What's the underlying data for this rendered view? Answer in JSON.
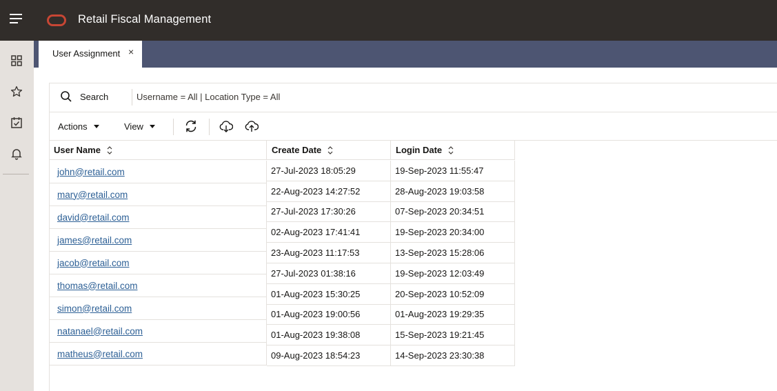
{
  "app": {
    "title": "Retail Fiscal Management"
  },
  "tab": {
    "label": "User Assignment",
    "close": "×"
  },
  "search": {
    "label": "Search",
    "filter": "Username = All | Location Type = All"
  },
  "toolbar": {
    "actions": "Actions",
    "view": "View"
  },
  "table": {
    "columns": [
      "User Name",
      "Create Date",
      "Login Date"
    ],
    "rows": [
      {
        "user": "john@retail.com",
        "create": "27-Jul-2023 18:05:29",
        "login": "19-Sep-2023 11:55:47"
      },
      {
        "user": "mary@retail.com",
        "create": "22-Aug-2023 14:27:52",
        "login": "28-Aug-2023 19:03:58"
      },
      {
        "user": "david@retail.com",
        "create": "27-Jul-2023 17:30:26",
        "login": "07-Sep-2023 20:34:51"
      },
      {
        "user": "james@retail.com",
        "create": "02-Aug-2023 17:41:41",
        "login": "19-Sep-2023 20:34:00"
      },
      {
        "user": "jacob@retail.com",
        "create": "23-Aug-2023 11:17:53",
        "login": "13-Sep-2023 15:28:06"
      },
      {
        "user": "thomas@retail.com",
        "create": "27-Jul-2023 01:38:16",
        "login": "19-Sep-2023 12:03:49"
      },
      {
        "user": "simon@retail.com",
        "create": "01-Aug-2023 15:30:25",
        "login": "20-Sep-2023 10:52:09"
      },
      {
        "user": "natanael@retail.com",
        "create": "01-Aug-2023 19:00:56",
        "login": "01-Aug-2023 19:29:35"
      },
      {
        "user": "matheus@retail.com",
        "create": "01-Aug-2023 19:38:08",
        "login": "15-Sep-2023 19:21:45"
      },
      {
        "user": "",
        "create": "09-Aug-2023 18:54:23",
        "login": "14-Sep-2023 23:30:38"
      }
    ]
  },
  "icons": {
    "menu": "hamburger-menu-icon",
    "brand": "oracle-logo-icon",
    "rail": [
      "grid-icon",
      "star-icon",
      "calendar-check-icon",
      "bell-icon"
    ],
    "search": "search-icon",
    "refresh": "refresh-icon",
    "download": "cloud-download-icon",
    "upload": "cloud-upload-icon",
    "sort": "sort-icon"
  },
  "colors": {
    "header": "#312d2a",
    "rail": "#e5e1dd",
    "tabstrip": "#4d5572",
    "link": "#2c5f95",
    "brand": "#c74634"
  }
}
